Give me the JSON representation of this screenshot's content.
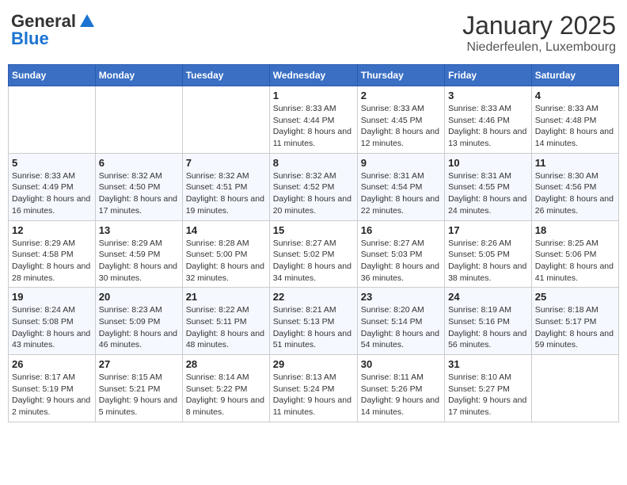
{
  "logo": {
    "general": "General",
    "blue": "Blue"
  },
  "header": {
    "month": "January 2025",
    "location": "Niederfeulen, Luxembourg"
  },
  "weekdays": [
    "Sunday",
    "Monday",
    "Tuesday",
    "Wednesday",
    "Thursday",
    "Friday",
    "Saturday"
  ],
  "weeks": [
    [
      {
        "day": "",
        "info": ""
      },
      {
        "day": "",
        "info": ""
      },
      {
        "day": "",
        "info": ""
      },
      {
        "day": "1",
        "info": "Sunrise: 8:33 AM\nSunset: 4:44 PM\nDaylight: 8 hours and 11 minutes."
      },
      {
        "day": "2",
        "info": "Sunrise: 8:33 AM\nSunset: 4:45 PM\nDaylight: 8 hours and 12 minutes."
      },
      {
        "day": "3",
        "info": "Sunrise: 8:33 AM\nSunset: 4:46 PM\nDaylight: 8 hours and 13 minutes."
      },
      {
        "day": "4",
        "info": "Sunrise: 8:33 AM\nSunset: 4:48 PM\nDaylight: 8 hours and 14 minutes."
      }
    ],
    [
      {
        "day": "5",
        "info": "Sunrise: 8:33 AM\nSunset: 4:49 PM\nDaylight: 8 hours and 16 minutes."
      },
      {
        "day": "6",
        "info": "Sunrise: 8:32 AM\nSunset: 4:50 PM\nDaylight: 8 hours and 17 minutes."
      },
      {
        "day": "7",
        "info": "Sunrise: 8:32 AM\nSunset: 4:51 PM\nDaylight: 8 hours and 19 minutes."
      },
      {
        "day": "8",
        "info": "Sunrise: 8:32 AM\nSunset: 4:52 PM\nDaylight: 8 hours and 20 minutes."
      },
      {
        "day": "9",
        "info": "Sunrise: 8:31 AM\nSunset: 4:54 PM\nDaylight: 8 hours and 22 minutes."
      },
      {
        "day": "10",
        "info": "Sunrise: 8:31 AM\nSunset: 4:55 PM\nDaylight: 8 hours and 24 minutes."
      },
      {
        "day": "11",
        "info": "Sunrise: 8:30 AM\nSunset: 4:56 PM\nDaylight: 8 hours and 26 minutes."
      }
    ],
    [
      {
        "day": "12",
        "info": "Sunrise: 8:29 AM\nSunset: 4:58 PM\nDaylight: 8 hours and 28 minutes."
      },
      {
        "day": "13",
        "info": "Sunrise: 8:29 AM\nSunset: 4:59 PM\nDaylight: 8 hours and 30 minutes."
      },
      {
        "day": "14",
        "info": "Sunrise: 8:28 AM\nSunset: 5:00 PM\nDaylight: 8 hours and 32 minutes."
      },
      {
        "day": "15",
        "info": "Sunrise: 8:27 AM\nSunset: 5:02 PM\nDaylight: 8 hours and 34 minutes."
      },
      {
        "day": "16",
        "info": "Sunrise: 8:27 AM\nSunset: 5:03 PM\nDaylight: 8 hours and 36 minutes."
      },
      {
        "day": "17",
        "info": "Sunrise: 8:26 AM\nSunset: 5:05 PM\nDaylight: 8 hours and 38 minutes."
      },
      {
        "day": "18",
        "info": "Sunrise: 8:25 AM\nSunset: 5:06 PM\nDaylight: 8 hours and 41 minutes."
      }
    ],
    [
      {
        "day": "19",
        "info": "Sunrise: 8:24 AM\nSunset: 5:08 PM\nDaylight: 8 hours and 43 minutes."
      },
      {
        "day": "20",
        "info": "Sunrise: 8:23 AM\nSunset: 5:09 PM\nDaylight: 8 hours and 46 minutes."
      },
      {
        "day": "21",
        "info": "Sunrise: 8:22 AM\nSunset: 5:11 PM\nDaylight: 8 hours and 48 minutes."
      },
      {
        "day": "22",
        "info": "Sunrise: 8:21 AM\nSunset: 5:13 PM\nDaylight: 8 hours and 51 minutes."
      },
      {
        "day": "23",
        "info": "Sunrise: 8:20 AM\nSunset: 5:14 PM\nDaylight: 8 hours and 54 minutes."
      },
      {
        "day": "24",
        "info": "Sunrise: 8:19 AM\nSunset: 5:16 PM\nDaylight: 8 hours and 56 minutes."
      },
      {
        "day": "25",
        "info": "Sunrise: 8:18 AM\nSunset: 5:17 PM\nDaylight: 8 hours and 59 minutes."
      }
    ],
    [
      {
        "day": "26",
        "info": "Sunrise: 8:17 AM\nSunset: 5:19 PM\nDaylight: 9 hours and 2 minutes."
      },
      {
        "day": "27",
        "info": "Sunrise: 8:15 AM\nSunset: 5:21 PM\nDaylight: 9 hours and 5 minutes."
      },
      {
        "day": "28",
        "info": "Sunrise: 8:14 AM\nSunset: 5:22 PM\nDaylight: 9 hours and 8 minutes."
      },
      {
        "day": "29",
        "info": "Sunrise: 8:13 AM\nSunset: 5:24 PM\nDaylight: 9 hours and 11 minutes."
      },
      {
        "day": "30",
        "info": "Sunrise: 8:11 AM\nSunset: 5:26 PM\nDaylight: 9 hours and 14 minutes."
      },
      {
        "day": "31",
        "info": "Sunrise: 8:10 AM\nSunset: 5:27 PM\nDaylight: 9 hours and 17 minutes."
      },
      {
        "day": "",
        "info": ""
      }
    ]
  ]
}
